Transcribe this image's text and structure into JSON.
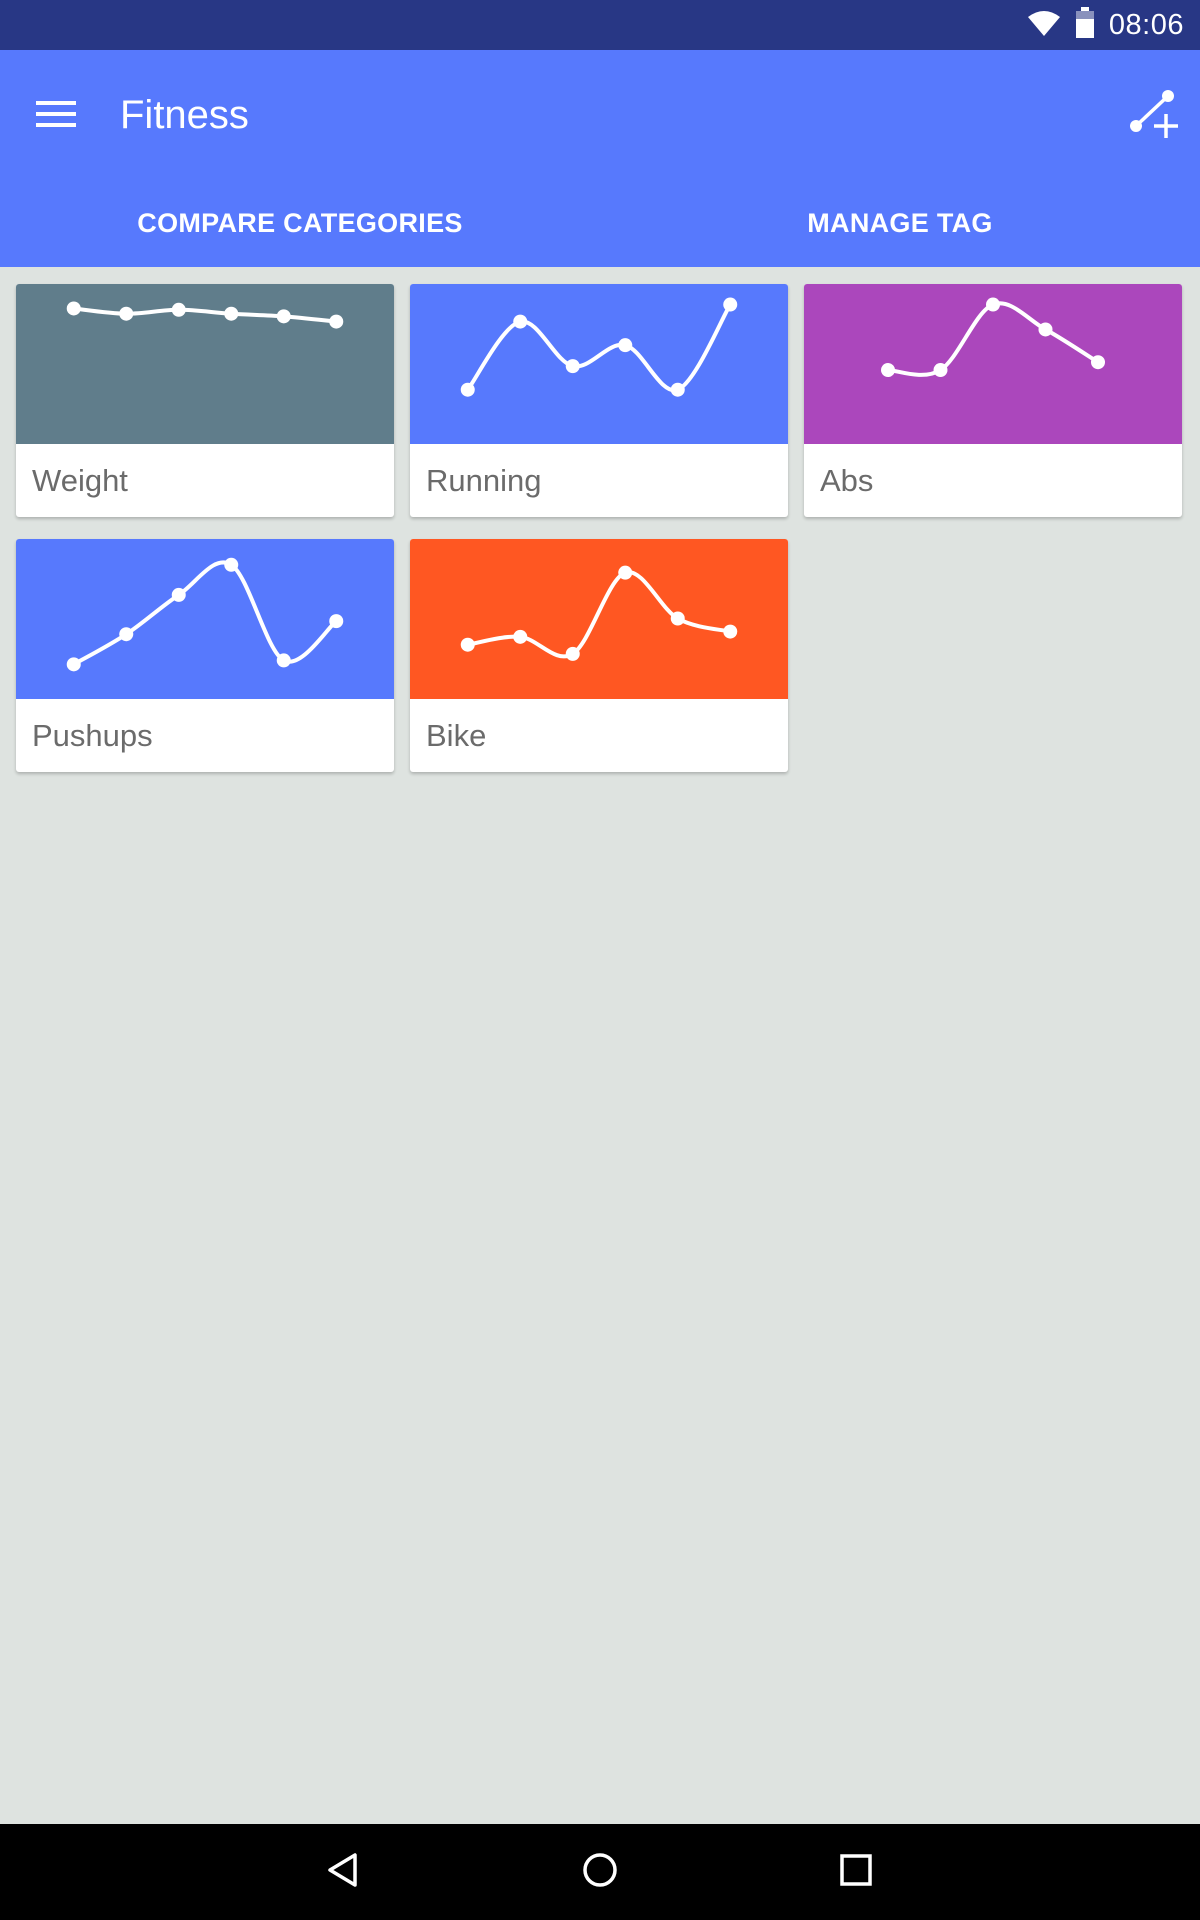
{
  "status_bar": {
    "time": "08:06",
    "icons": [
      "wifi-icon",
      "battery-icon"
    ]
  },
  "app_bar": {
    "title": "Fitness",
    "menu_icon": "menu-icon",
    "action_icon": "add-graph-icon",
    "tabs": [
      {
        "label": "COMPARE CATEGORIES"
      },
      {
        "label": "MANAGE TAG"
      }
    ]
  },
  "categories": [
    {
      "name": "Weight",
      "color": "#607d8b",
      "points": [
        0.92,
        0.88,
        0.91,
        0.88,
        0.86,
        0.82
      ]
    },
    {
      "name": "Running",
      "color": "#5779fd",
      "points": [
        0.3,
        0.82,
        0.48,
        0.64,
        0.3,
        0.95
      ]
    },
    {
      "name": "Abs",
      "color": "#ab47bc",
      "points": [
        0.45,
        0.45,
        0.95,
        0.76,
        0.51
      ]
    },
    {
      "name": "Pushups",
      "color": "#5779fd",
      "points": [
        0.15,
        0.38,
        0.68,
        0.91,
        0.18,
        0.48
      ]
    },
    {
      "name": "Bike",
      "color": "#ff5722",
      "points": [
        0.3,
        0.36,
        0.23,
        0.85,
        0.5,
        0.4
      ]
    }
  ],
  "nav_bar": {
    "icons": [
      "back-icon",
      "home-icon",
      "recents-icon"
    ]
  }
}
